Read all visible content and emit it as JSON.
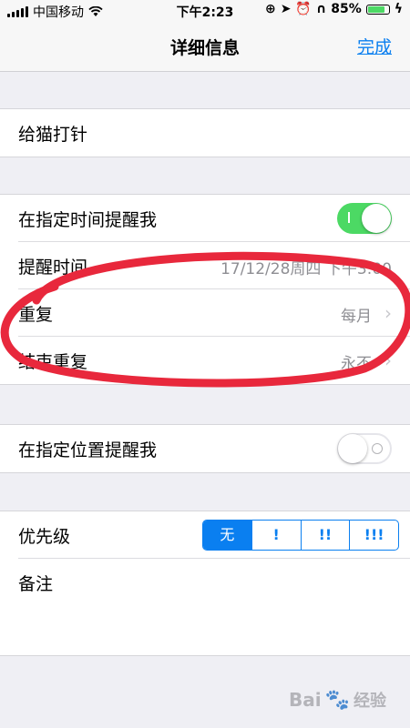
{
  "status_bar": {
    "carrier": "中国移动",
    "time": "下午2:23",
    "battery": "85%",
    "battery_level": 0.85
  },
  "nav": {
    "title": "详细信息",
    "done": "完成"
  },
  "group_title": {
    "title": "给猫打针"
  },
  "group_time": {
    "remind_at_time": {
      "label": "在指定时间提醒我",
      "on": true
    },
    "remind_time": {
      "label": "提醒时间",
      "value": "17/12/28周四 下午3:00"
    },
    "repeat": {
      "label": "重复",
      "value": "每月"
    },
    "end_repeat": {
      "label": "结束重复",
      "value": "永不"
    }
  },
  "group_location": {
    "remind_at_location": {
      "label": "在指定位置提醒我",
      "on": false
    }
  },
  "group_priority": {
    "priority": {
      "label": "优先级",
      "options": [
        "无",
        "!",
        "!!",
        "!!!"
      ],
      "selected": 0
    },
    "notes": {
      "label": "备注"
    }
  },
  "watermark": {
    "brand": "Bai",
    "sub": "经验"
  },
  "colors": {
    "accent": "#0a7ff0",
    "toggle_on": "#4cd964",
    "annotation": "#e8283c"
  }
}
